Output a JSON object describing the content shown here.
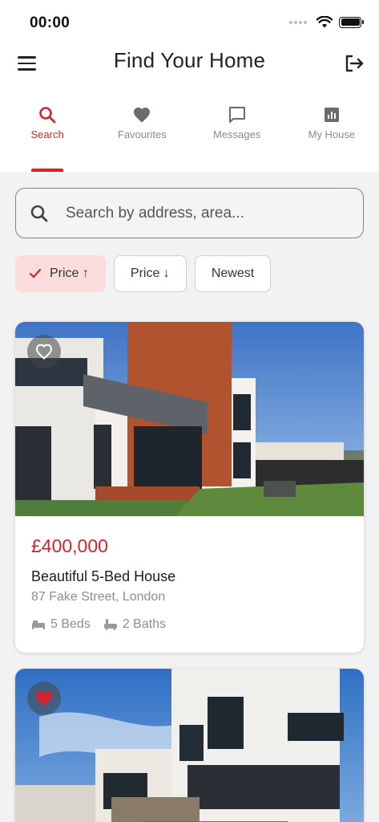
{
  "status_bar": {
    "time": "00:00"
  },
  "header": {
    "title": "Find Your Home"
  },
  "tabs": [
    {
      "label": "Search",
      "icon": "search-icon",
      "active": true
    },
    {
      "label": "Favourites",
      "icon": "heart-icon",
      "active": false
    },
    {
      "label": "Messages",
      "icon": "chat-icon",
      "active": false
    },
    {
      "label": "My House",
      "icon": "chart-icon",
      "active": false
    }
  ],
  "search": {
    "placeholder": "Search by address, area...",
    "value": ""
  },
  "filters": [
    {
      "label": "Price ↑",
      "selected": true
    },
    {
      "label": "Price ↓",
      "selected": false
    },
    {
      "label": "Newest",
      "selected": false
    }
  ],
  "listings": [
    {
      "price": "£400,000",
      "title": "Beautiful 5-Bed House",
      "address": "87 Fake Street, London",
      "beds": "5 Beds",
      "baths": "2 Baths",
      "favourite": false
    },
    {
      "favourite": true
    }
  ],
  "colors": {
    "accent": "#d3232e",
    "chip_selected_bg": "#fbdcdc",
    "background": "#f2f2f2"
  }
}
